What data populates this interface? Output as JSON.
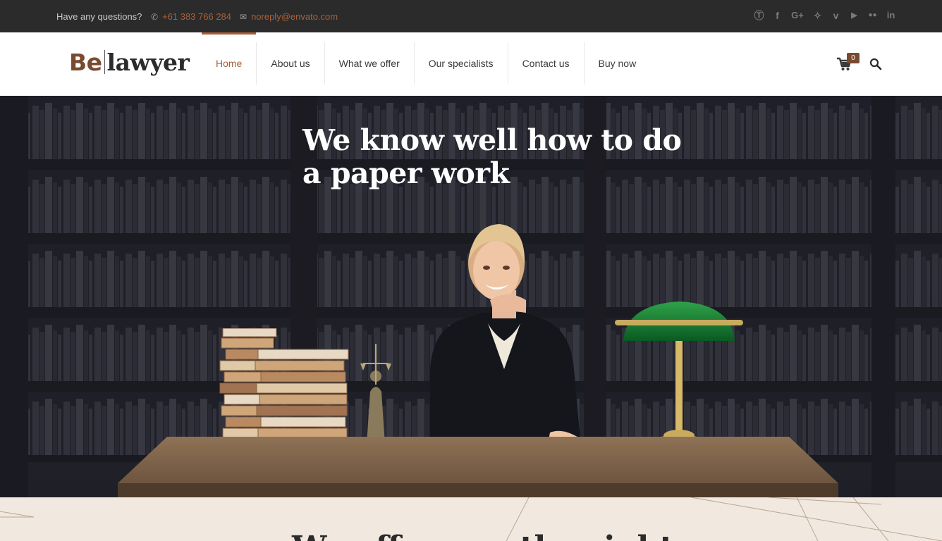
{
  "topbar": {
    "question": "Have any questions?",
    "phone": "+61 383 766 284",
    "email": "noreply@envato.com",
    "social": [
      "skype-icon",
      "facebook-icon",
      "google-plus-icon",
      "twitter-icon",
      "vimeo-icon",
      "youtube-icon",
      "flickr-icon",
      "linkedin-icon"
    ]
  },
  "logo": {
    "be": "Be",
    "lawyer": "lawyer"
  },
  "nav": {
    "items": [
      "Home",
      "About us",
      "What we offer",
      "Our specialists",
      "Contact us",
      "Buy now"
    ],
    "active": "Home"
  },
  "cart": {
    "count": "0"
  },
  "hero": {
    "line1": "We know well how to do",
    "line2": "a paper work"
  },
  "lower": {
    "title": "We offer you the right"
  },
  "colors": {
    "accent": "#a8603a",
    "topbar_bg": "#2b2b2b",
    "lamp_green": "#0f7a2e"
  }
}
